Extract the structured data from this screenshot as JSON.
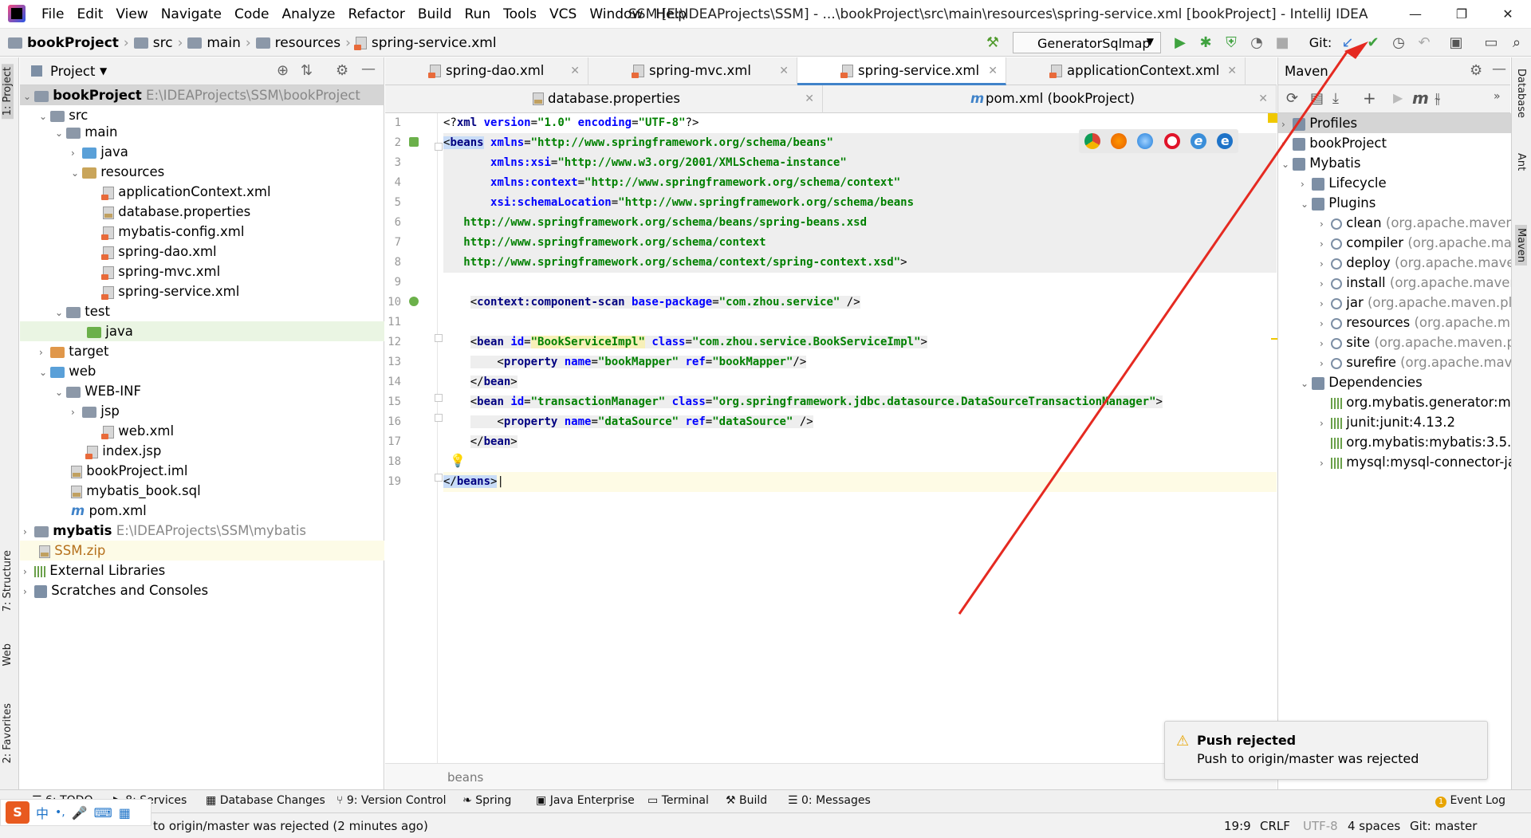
{
  "title_bar": {
    "menu": [
      "File",
      "Edit",
      "View",
      "Navigate",
      "Code",
      "Analyze",
      "Refactor",
      "Build",
      "Run",
      "Tools",
      "VCS",
      "Window",
      "Help"
    ],
    "window_title": "SSM [E:\\IDEAProjects\\SSM] - ...\\bookProject\\src\\main\\resources\\spring-service.xml [bookProject] - IntelliJ IDEA"
  },
  "nav_bar": {
    "breadcrumbs": [
      "bookProject",
      "src",
      "main",
      "resources",
      "spring-service.xml"
    ],
    "run_config": "GeneratorSqlmap",
    "git_label": "Git:"
  },
  "left_strip": {
    "tabs": [
      "1: Project",
      "7: Structure",
      "Web",
      "2: Favorites"
    ]
  },
  "right_strip": {
    "tabs": [
      "Database",
      "Ant",
      "Maven"
    ]
  },
  "project_panel": {
    "title": "Project",
    "tree": [
      {
        "label": "bookProject",
        "path": "E:\\IDEAProjects\\SSM\\bookProject"
      },
      {
        "label": "src"
      },
      {
        "label": "main"
      },
      {
        "label": "java"
      },
      {
        "label": "resources"
      },
      {
        "label": "applicationContext.xml"
      },
      {
        "label": "database.properties"
      },
      {
        "label": "mybatis-config.xml"
      },
      {
        "label": "spring-dao.xml"
      },
      {
        "label": "spring-mvc.xml"
      },
      {
        "label": "spring-service.xml"
      },
      {
        "label": "test"
      },
      {
        "label": "java"
      },
      {
        "label": "target"
      },
      {
        "label": "web"
      },
      {
        "label": "WEB-INF"
      },
      {
        "label": "jsp"
      },
      {
        "label": "web.xml"
      },
      {
        "label": "index.jsp"
      },
      {
        "label": "bookProject.iml"
      },
      {
        "label": "mybatis_book.sql"
      },
      {
        "label": "pom.xml"
      },
      {
        "label": "mybatis",
        "path": "E:\\IDEAProjects\\SSM\\mybatis"
      },
      {
        "label": "SSM.zip"
      },
      {
        "label": "External Libraries"
      },
      {
        "label": "Scratches and Consoles"
      }
    ]
  },
  "editor": {
    "tabs_row1": [
      "spring-dao.xml",
      "spring-mvc.xml",
      "spring-service.xml",
      "applicationContext.xml"
    ],
    "tabs_row2": [
      "database.properties",
      "pom.xml (bookProject)"
    ],
    "breadcrumb": "beans",
    "line_numbers": [
      "1",
      "2",
      "3",
      "4",
      "5",
      "6",
      "7",
      "8",
      "9",
      "10",
      "11",
      "12",
      "13",
      "14",
      "15",
      "16",
      "17",
      "18",
      "19"
    ]
  },
  "maven_panel": {
    "title": "Maven",
    "tree": [
      {
        "label": "Profiles"
      },
      {
        "label": "bookProject"
      },
      {
        "label": "Mybatis"
      },
      {
        "label": "Lifecycle"
      },
      {
        "label": "Plugins"
      },
      {
        "label": "clean",
        "detail": "(org.apache.maven.p"
      },
      {
        "label": "compiler",
        "detail": "(org.apache.mav"
      },
      {
        "label": "deploy",
        "detail": "(org.apache.maver"
      },
      {
        "label": "install",
        "detail": "(org.apache.maven."
      },
      {
        "label": "jar",
        "detail": "(org.apache.maven.plu"
      },
      {
        "label": "resources",
        "detail": "(org.apache.ma"
      },
      {
        "label": "site",
        "detail": "(org.apache.maven.pl"
      },
      {
        "label": "surefire",
        "detail": "(org.apache.mave"
      },
      {
        "label": "Dependencies"
      },
      {
        "label": "org.mybatis.generator:my"
      },
      {
        "label": "junit:junit:4.13.2"
      },
      {
        "label": "org.mybatis:mybatis:3.5.9"
      },
      {
        "label": "mysql:mysql-connector-ja"
      }
    ]
  },
  "notification": {
    "title": "Push rejected",
    "body": "Push to origin/master was rejected"
  },
  "tool_windows": [
    "6: TODO",
    "8: Services",
    "Database Changes",
    "9: Version Control",
    "Spring",
    "Java Enterprise",
    "Terminal",
    "Build",
    "0: Messages",
    "Event Log"
  ],
  "status_bar": {
    "message": "to origin/master was rejected (2 minutes ago)",
    "position": "19:9",
    "line_sep": "CRLF",
    "encoding": "UTF-8",
    "indent": "4 spaces",
    "vcs": "Git: master"
  }
}
